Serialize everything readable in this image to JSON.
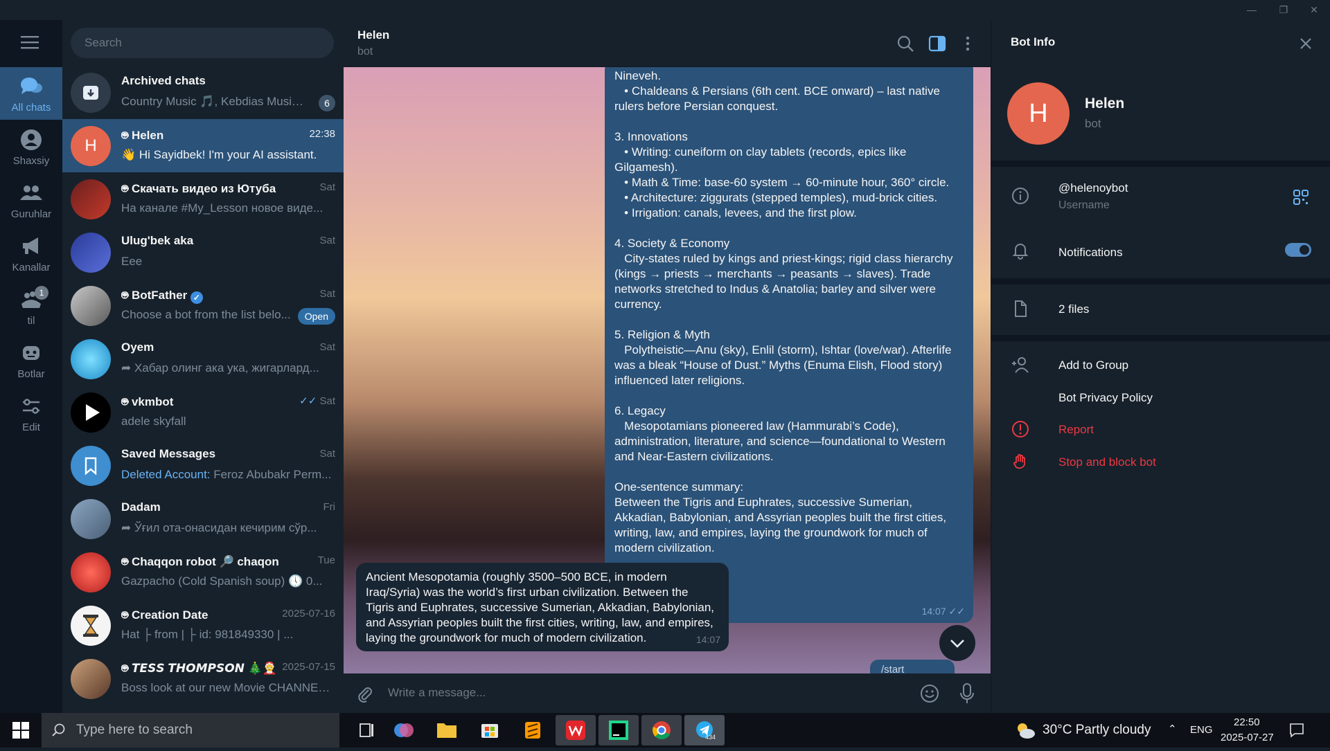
{
  "window": {
    "minimize": "—",
    "maximize": "❐",
    "close": "✕"
  },
  "rail": [
    {
      "label": "All chats",
      "icon": "chat-bubbles-icon",
      "active": true
    },
    {
      "label": "Shaxsiy",
      "icon": "person-icon"
    },
    {
      "label": "Guruhlar",
      "icon": "group-icon"
    },
    {
      "label": "Kanallar",
      "icon": "megaphone-icon"
    },
    {
      "label": "til",
      "icon": "folder-icon",
      "badge": "1"
    },
    {
      "label": "Botlar",
      "icon": "robot-icon"
    },
    {
      "label": "Edit",
      "icon": "sliders-icon"
    }
  ],
  "search": {
    "placeholder": "Search"
  },
  "chats": [
    {
      "name": "Archived chats",
      "time": "",
      "preview": "Country Music 🎵, Kebdias Musik ...",
      "badge": "6"
    },
    {
      "name": "Helen",
      "time": "22:38",
      "preview": "👋 Hi Sayidbek! I'm your AI assistant."
    },
    {
      "name": "Скачать видео из Ютуба",
      "time": "Sat",
      "preview": "На канале #My_Lesson новое виде..."
    },
    {
      "name": "Ulug'bek aka",
      "time": "Sat",
      "preview": "Eee"
    },
    {
      "name": "BotFather",
      "time": "Sat",
      "preview": "Choose a bot from the list belo...",
      "badge": "Open"
    },
    {
      "name": "Oyem",
      "time": "Sat",
      "preview": "Хабар олинг ака ука, жигарлард..."
    },
    {
      "name": "vkmbot",
      "time": "Sat",
      "preview": "adele skyfall"
    },
    {
      "name": "Saved Messages",
      "time": "Sat",
      "preview_prefix": "Deleted Account:",
      "preview": "Feroz Abubakr  Perm..."
    },
    {
      "name": "Dadam",
      "time": "Fri",
      "preview": "Ўғил ота-онасидан кечирим сўр..."
    },
    {
      "name": "Chaqqon robot 🔎 chaqon",
      "time": "Tue",
      "preview": "Gazpacho (Cold Spanish soup) 🕔 0..."
    },
    {
      "name": "Creation Date",
      "time": "2025-07-16",
      "preview": "Hat   ├ from     |     ├ id: 981849330    |     ..."
    },
    {
      "name": "𝙏𝙀𝙎𝙎 𝙏𝙃𝙊𝙈𝙋𝙎𝙊𝙉 🎄🤶",
      "time": "2025-07-15",
      "preview": "Boss look at our new Movie CHANNEL ..."
    }
  ],
  "header": {
    "name": "Helen",
    "subtitle": "bot"
  },
  "message_out": {
    "lines": [
      "Nineveh.",
      "   • Chaldeans & Persians (6th cent. BCE onward) – last native rulers before Persian conquest.",
      "",
      "3. Innovations",
      "   • Writing: cuneiform on clay tablets (records, epics like Gilgamesh).",
      "   • Math & Time: base-60 system → 60-minute hour, 360° circle.",
      "   • Architecture: ziggurats (stepped temples), mud-brick cities.",
      "   • Irrigation: canals, levees, and the first plow.",
      "",
      "4. Society & Economy",
      "   City-states ruled by kings and priest-kings; rigid class hierarchy (kings → priests → merchants → peasants → slaves). Trade networks stretched to Indus & Anatolia; barley and silver were currency.",
      "",
      "5. Religion & Myth",
      "   Polytheistic—Anu (sky), Enlil (storm), Ishtar (love/war). Afterlife was a bleak “House of Dust.” Myths (Enuma Elish, Flood story) influenced later religions.",
      "",
      "6. Legacy",
      "   Mesopotamians pioneered law (Hammurabi’s Code), administration, literature, and science—foundational to Western and Near-Eastern civilizations.",
      "",
      "One-sentence summary:",
      "Between the Tigris and Euphrates, successive Sumerian, Akkadian, Babylonian, and Assyrian peoples built the first cities, writing, law, and empires, laying the groundwork for much of modern civilization."
    ],
    "time": "14:07"
  },
  "message_in": {
    "text": "Ancient Mesopotamia (roughly 3500–500 BCE, in modern Iraq/Syria) was the world’s first urban civilization. Between the Tigris and Euphrates, successive Sumerian, Akkadian, Babylonian, and Assyrian peoples built the first cities, writing, law, and empires, laying the groundwork for much of modern civilization.",
    "time": "14:07"
  },
  "start_chip": "/start",
  "composer": {
    "placeholder": "Write a message..."
  },
  "panel": {
    "title": "Bot Info",
    "name": "Helen",
    "subtitle": "bot",
    "avatar_letter": "H",
    "username": "@helenoybot",
    "username_label": "Username",
    "notifications": "Notifications",
    "notifications_on": true,
    "files": "2 files",
    "add_to_group": "Add to Group",
    "privacy": "Bot Privacy Policy",
    "report": "Report",
    "stop_block": "Stop and block bot"
  },
  "taskbar": {
    "search_placeholder": "Type here to search",
    "weather": "30°C  Partly cloudy",
    "language": "ENG",
    "time": "22:50",
    "date": "2025-07-27",
    "telegram_badge": "434"
  },
  "colors": {
    "accent": "#2b5278",
    "link": "#6ab3f3",
    "danger": "#ec3942",
    "avatar_helen": "#e5664e"
  }
}
